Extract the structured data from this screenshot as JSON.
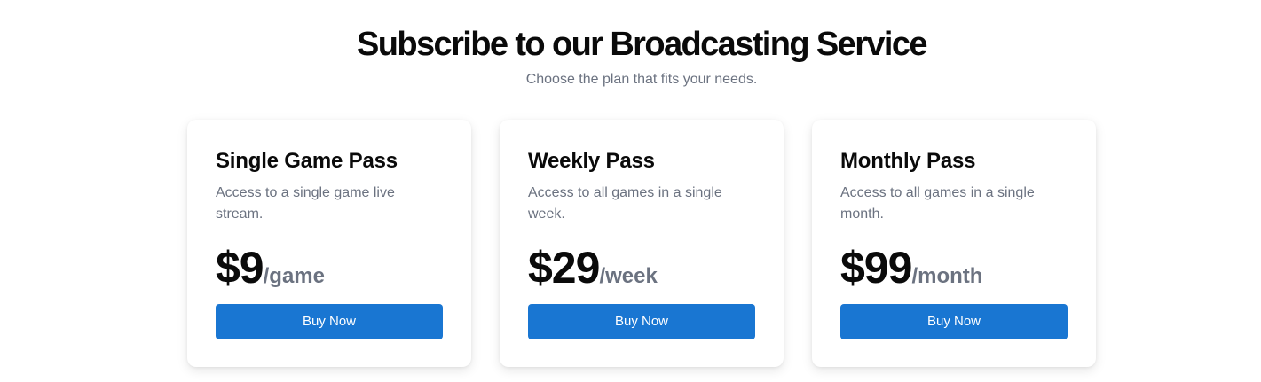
{
  "header": {
    "title": "Subscribe to our Broadcasting Service",
    "subtitle": "Choose the plan that fits your needs."
  },
  "plans": [
    {
      "name": "Single Game Pass",
      "description": "Access to a single game live stream.",
      "price": "$9",
      "period": "/game",
      "button_label": "Buy Now"
    },
    {
      "name": "Weekly Pass",
      "description": "Access to all games in a single week.",
      "price": "$29",
      "period": "/week",
      "button_label": "Buy Now"
    },
    {
      "name": "Monthly Pass",
      "description": "Access to all games in a single month.",
      "price": "$99",
      "period": "/month",
      "button_label": "Buy Now"
    }
  ],
  "colors": {
    "accent": "#1976d2",
    "muted_text": "#6b7280",
    "heading_text": "#0a0a0a",
    "background": "#ffffff"
  }
}
